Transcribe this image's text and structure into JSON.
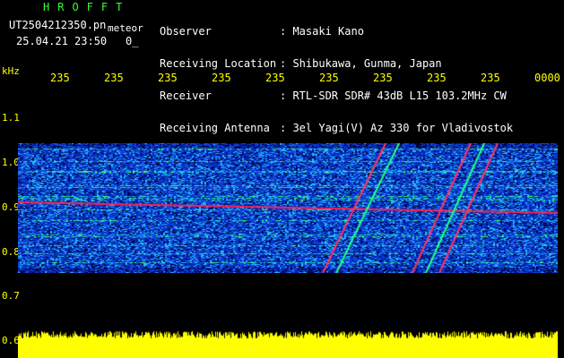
{
  "header": {
    "brand": "HROFFT",
    "filename": "UT2504212350.pn",
    "mode": "meteor",
    "datetime": "25.04.21 23:50",
    "count": "0_"
  },
  "info": {
    "labels": [
      "Observer",
      "Receiving Location",
      "Receiver",
      "Receiving Antenna"
    ],
    "values": [
      ": Masaki Kano",
      ": Shibukawa, Gunma, Japan",
      ": RTL-SDR SDR# 43dB L15 103.2MHz CW",
      ": 3el Yagi(V) Az 330 for Vladivostok"
    ]
  },
  "axis": {
    "y_unit": "kHz",
    "x_ticks": [
      "235",
      "235",
      "235",
      "235",
      "235",
      "235",
      "235",
      "235",
      "235",
      "0000"
    ],
    "y_ticks": [
      "1.1",
      "1.0",
      "0.9",
      "0.8",
      "0.7",
      "0.6"
    ]
  },
  "colors": {
    "brand": "#33ff33",
    "text": "#ffffff",
    "axis": "#ffff00",
    "background": "#000000"
  }
}
